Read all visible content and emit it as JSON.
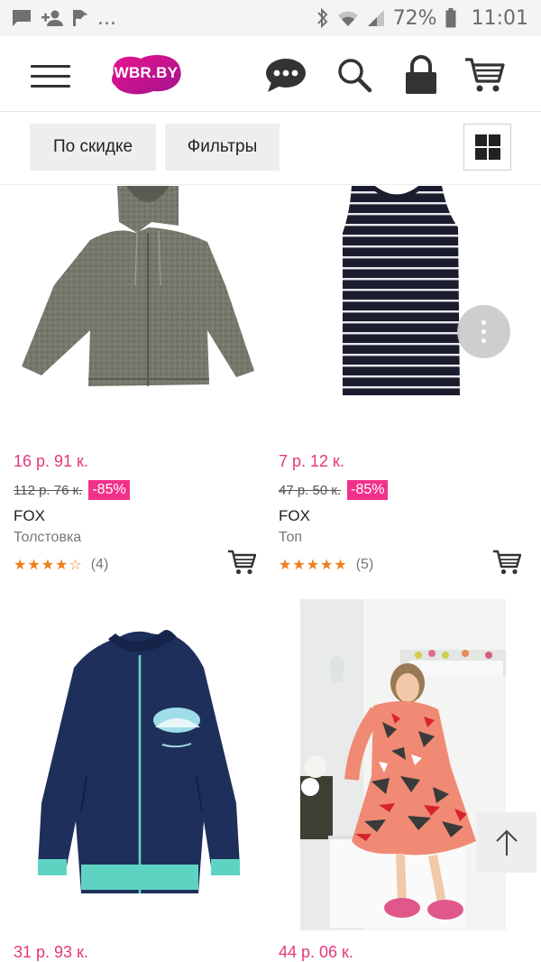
{
  "status_bar": {
    "notification_icons": [
      "message-icon",
      "add-person-icon",
      "task-icon"
    ],
    "overflow": "...",
    "battery": "72%",
    "time": "11:01"
  },
  "header": {
    "logo_text": "WBR.BY",
    "icons": [
      "menu-icon",
      "chat-icon",
      "search-icon",
      "lock-icon",
      "cart-icon"
    ],
    "brand_color": "#cb11ab"
  },
  "toolbar": {
    "sort_label": "По скидке",
    "filter_label": "Фильтры",
    "view_icon": "grid-view-icon"
  },
  "products": [
    {
      "image": "grey-zip-hoodie",
      "price": "16 р. 91 к.",
      "old_price": "112 р. 76 к.",
      "discount": "-85%",
      "brand": "FOX",
      "type": "Толстовка",
      "stars": "★★★★☆",
      "rating_value": 4,
      "reviews": "(4)"
    },
    {
      "image": "striped-tank-top",
      "price": "7 р. 12 к.",
      "old_price": "47 р. 50 к.",
      "discount": "-85%",
      "brand": "FOX",
      "type": "Топ",
      "stars": "★★★★★",
      "rating_value": 5,
      "reviews": "(5)"
    },
    {
      "image": "navy-zip-jacket",
      "price": "31 р. 93 к."
    },
    {
      "image": "girl-in-camo-dress",
      "price": "44 р. 06 к."
    }
  ],
  "colors": {
    "price": "#e4387a",
    "discount_badge": "#f2328a",
    "stars": "#f07d1b"
  }
}
